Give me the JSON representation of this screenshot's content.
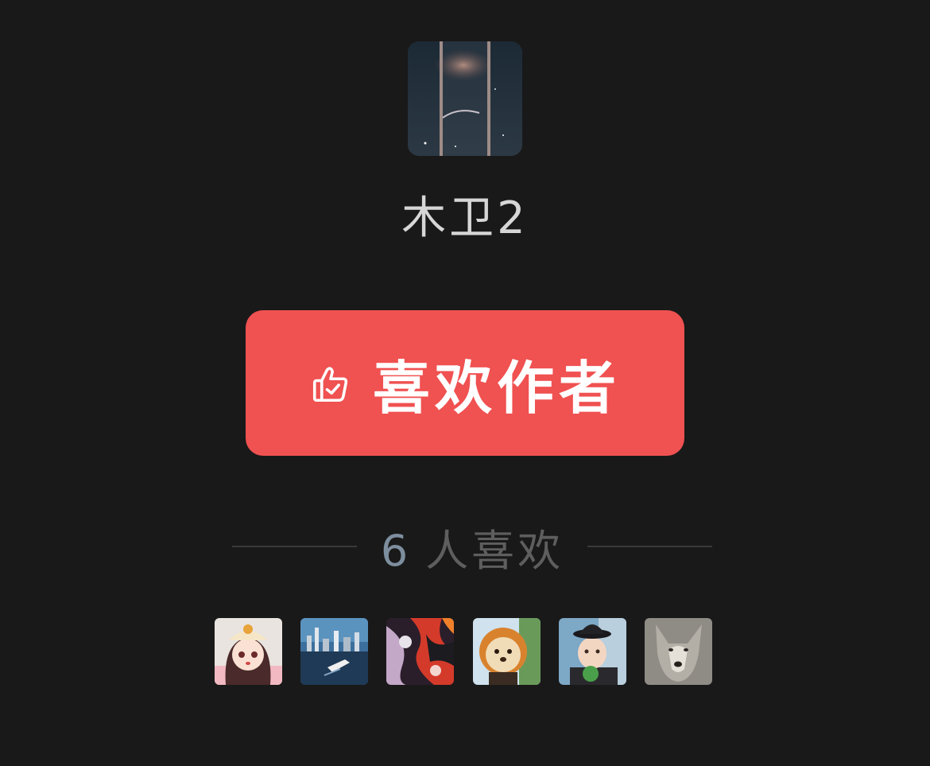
{
  "author": {
    "name": "木卫2",
    "avatar_icon": "night-moon-avatar"
  },
  "like_button": {
    "label": "喜欢作者",
    "icon": "thumbs-up-check-icon",
    "color": "#f05151"
  },
  "likes": {
    "count": "6",
    "suffix": "人喜欢"
  },
  "fans": [
    {
      "icon": "anime-girl-avatar"
    },
    {
      "icon": "city-ship-avatar"
    },
    {
      "icon": "abstract-paint-avatar"
    },
    {
      "icon": "bear-toy-avatar"
    },
    {
      "icon": "boy-hat-avatar"
    },
    {
      "icon": "wolf-avatar"
    }
  ]
}
